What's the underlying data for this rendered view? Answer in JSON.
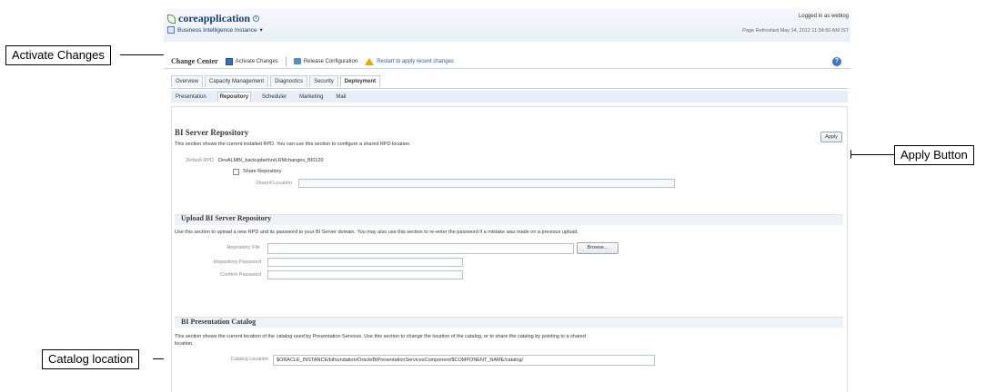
{
  "callouts": {
    "activate": "Activate Changes",
    "apply": "Apply Button",
    "catalog": "Catalog location"
  },
  "header": {
    "app_name": "coreapplication",
    "subtitle": "Business Intelligence Instance",
    "logged_in": "Logged in as  weblog",
    "refreshed": "Page Refreshed May 14, 2012 11:34:50 AM IST"
  },
  "change_center": {
    "title": "Change Center",
    "activate": "Activate Changes",
    "release": "Release Configuration",
    "restart": "Restart to apply recent changes"
  },
  "tabs": [
    "Overview",
    "Capacity Management",
    "Diagnostics",
    "Security",
    "Deployment"
  ],
  "subtabs": [
    "Presentation",
    "Repository",
    "Scheduler",
    "Marketing",
    "Mail"
  ],
  "repository": {
    "heading": "BI Server Repository",
    "description": "This section shows the current installed RPD. You can use this section to configure a shared RPD location.",
    "apply": "Apply",
    "default_rpd_label": "Default RPD",
    "default_rpd_value": "DevALMBI_backupbeforeLRMchanges_BI0120",
    "share_label": "Share Repository",
    "shared_location_label": "Shared Location"
  },
  "upload": {
    "heading": "Upload BI Server Repository",
    "description": "Use this section to upload a new RPD and its password to your BI Server domain. You may also use this section to re-enter the password if a mistake was made on a previous upload.",
    "file_label": "Repository File",
    "browse": "Browse...",
    "password_label": "Repository Password",
    "confirm_label": "Confirm Password"
  },
  "catalog": {
    "heading": "BI Presentation Catalog",
    "description_1": "This section shows the current location of the catalog used by Presentation Services. Use this section to change the location of the catalog, or to share the catalog by pointing to a shared",
    "description_2": "location.",
    "location_label": "Catalog Location",
    "location_value": "$ORACLE_INSTANCE/bifoundation/OracleBIPresentationServicesComponent/$COMPONENT_NAME/catalog/"
  }
}
